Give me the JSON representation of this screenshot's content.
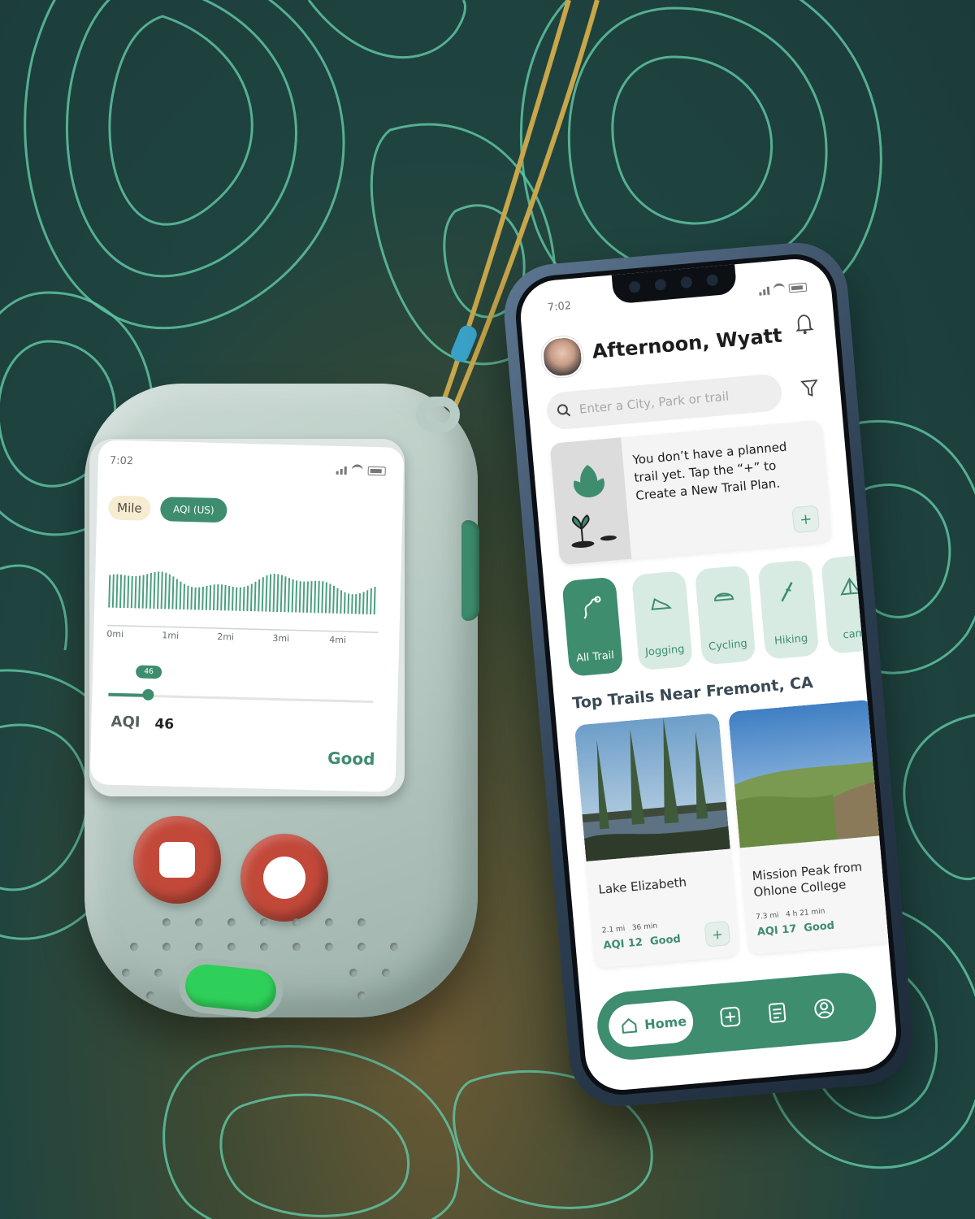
{
  "device": {
    "time": "7:02",
    "unit_chip": "Mile",
    "metric_chip": "AQI (US)",
    "distance_ticks": [
      "0mi",
      "1mi",
      "2mi",
      "3mi",
      "4mi"
    ],
    "slider_badge": "46",
    "aqi_label": "AQI",
    "aqi_value": "46",
    "aqi_status": "Good",
    "aqi_level_fraction": 0.15
  },
  "phone": {
    "time": "7:02",
    "greeting": "Afternoon, Wyatt",
    "search_placeholder": "Enter a City, Park or trail",
    "plan_card": {
      "message": "You don’t have a planned trail yet. Tap the “+” to Create a New Trail Plan."
    },
    "categories": [
      {
        "label": "All Trail",
        "icon": "trail-map-icon",
        "active": true
      },
      {
        "label": "Jogging",
        "icon": "shoe-icon",
        "active": false
      },
      {
        "label": "Cycling",
        "icon": "helmet-icon",
        "active": false
      },
      {
        "label": "Hiking",
        "icon": "hiking-stick-icon",
        "active": false
      },
      {
        "label": "cam",
        "icon": "tent-icon",
        "active": false
      }
    ],
    "section_title": "Top Trails Near Fremont, CA",
    "trails": [
      {
        "name": "Lake Elizabeth",
        "distance": "2.1 mi",
        "duration": "36 min",
        "aqi": "AQI 12",
        "status": "Good"
      },
      {
        "name": "Mission Peak from Ohlone College",
        "distance": "7.3 mi",
        "duration": "4 h 21 min",
        "aqi": "AQI 17",
        "status": "Good"
      }
    ],
    "nav": {
      "home_label": "Home",
      "items": [
        "add-icon",
        "notes-icon",
        "profile-icon"
      ]
    }
  },
  "colors": {
    "accent": "#3d8d6e",
    "topo_line": "#5fc3a0",
    "button_red": "#c2493a",
    "button_green": "#2fd05a",
    "chip_cream": "#f6ecd2"
  }
}
